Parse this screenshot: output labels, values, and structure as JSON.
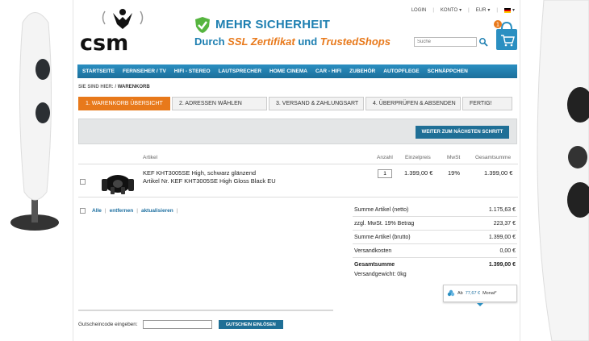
{
  "header": {
    "banner_title": "MEHR SICHERHEIT",
    "banner_sub_prefix": "Durch ",
    "banner_sub_ssl": "SSL Zertifikat",
    "banner_sub_mid": " und ",
    "banner_sub_trusted": "TrustedShops",
    "login": "LOGIN",
    "konto": "KONTO",
    "currency": "EUR",
    "search_placeholder": "Suche",
    "cart_count": "1"
  },
  "nav": {
    "items": [
      "STARTSEITE",
      "FERNSEHER / TV",
      "HIFI - STEREO",
      "LAUTSPRECHER",
      "HOME CINEMA",
      "CAR - HIFI",
      "ZUBEHÖR",
      "AUTOPFLEGE",
      "SCHNÄPPCHEN"
    ]
  },
  "breadcrumb": {
    "prefix": "SIE SIND HIER: / ",
    "current": "WARENKORB"
  },
  "steps": [
    "1. WARENKORB ÜBERSICHT",
    "2. ADRESSEN WÄHLEN",
    "3. VERSAND & ZAHLUNGSART",
    "4. ÜBERPRÜFEN & ABSENDEN",
    "FERTIG!"
  ],
  "continue_label": "WEITER ZUM NÄCHSTEN SCHRITT",
  "table": {
    "headers": {
      "artikel": "Artikel",
      "anzahl": "Anzahl",
      "einzelpreis": "Einzelpreis",
      "mwst": "MwSt",
      "gesamtsumme": "Gesamtsumme"
    },
    "row": {
      "name": "KEF KHT3005SE High, schwarz glänzend",
      "article_no": "Artikel Nr. KEF KHT3005SE High Gloss Black EU",
      "qty": "1",
      "unit_price": "1.399,00 €",
      "vat": "19%",
      "total": "1.399,00 €"
    }
  },
  "actions": {
    "all": "Alle",
    "remove": "entfernen",
    "update": "aktualisieren"
  },
  "summary": {
    "netto_label": "Summe Artikel (netto)",
    "netto_value": "1.175,63 €",
    "tax_label": "zzgl. MwSt. 19% Betrag",
    "tax_value": "223,37 €",
    "brutto_label": "Summe Artikel (brutto)",
    "brutto_value": "1.399,00 €",
    "shipping_label": "Versandkosten",
    "shipping_value": "0,00 €",
    "total_label": "Gesamtsumme",
    "total_value": "1.399,00 €",
    "weight": "Versandgewicht: 0kg"
  },
  "finance": {
    "prefix": "Ab",
    "rate": "77,67 €",
    "suffix": "Monat*"
  },
  "voucher": {
    "label": "Gutscheincode eingeben:",
    "button": "GUTSCHEIN EINLÖSEN"
  }
}
